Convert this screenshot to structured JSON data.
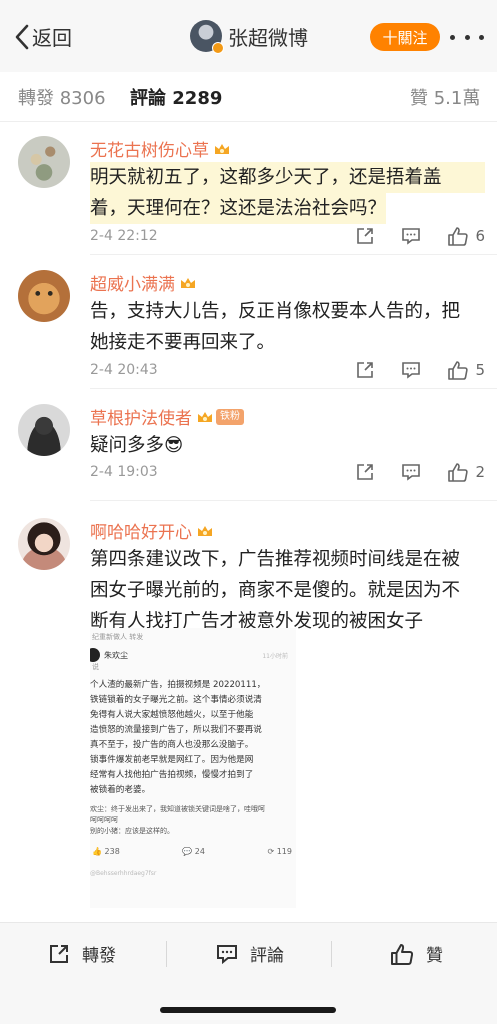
{
  "header": {
    "back_label": "返回",
    "title": "张超微博",
    "follow_label": "十關注"
  },
  "tabs": [
    {
      "label": "轉發 8306",
      "active": false
    },
    {
      "label": "評論 2289",
      "active": true
    },
    {
      "label": "贊 5.1萬",
      "active": false
    }
  ],
  "comments": [
    {
      "name": "无花古树伤心草",
      "text_lines": [
        "明天就初五了，这都多少天了，还是捂着盖",
        "着，天理何在？这还是法治社会吗？"
      ],
      "time": "2-4 22:12",
      "likes": "6"
    },
    {
      "name": "超威小满满",
      "text_lines": [
        "告，支持大儿告，反正肖像权要本人告的，把",
        "她接走不要再回来了。"
      ],
      "time": "2-4 20:43",
      "likes": "5"
    },
    {
      "name": "草根护法使者",
      "badge": "铁粉",
      "text_lines": [
        "疑问多多😎"
      ],
      "time": "2-4 19:03",
      "likes": "2"
    },
    {
      "name": "啊哈哈好开心",
      "text_lines": [
        "第四条建议改下，广告推荐视频时间线是在被",
        "困女子曝光前的，商家不是傻的。就是因为不",
        "断有人找打广告才被意外发现的被困女子"
      ]
    }
  ],
  "embed": {
    "header": "纪重新做人 转发",
    "user": "朱欢尘",
    "user_time": "11小时前",
    "user_sub": "说",
    "body_lines": [
      "个人渣的最新广告，拍摄视频是 20220111，",
      "铁链锁着的女子曝光之前。这个事情必须说清",
      "免得有人说大家越愤怒他越火，以至于他能",
      "造愤怒的流量接到广告了，所以我们不要再说",
      "真不至于，投广告的商人也没那么没脑子。",
      "锁事件爆发前老早就是网红了。因为他是网",
      "经常有人找他拍广告拍视频，慢慢才拍到了",
      "被锁着的老婆。"
    ],
    "reply_lines": [
      "欢尘：终于发出来了，我知道被锁关键词是啥了，哇哦呵",
      "呵呵呵呵",
      "别的小猪：应该是这样的。"
    ],
    "likes": "238",
    "comments": "24",
    "reposts": "119",
    "watermark": "@Behsserhhrdaeg7fsr"
  },
  "bottom": {
    "repost_label": "轉發",
    "comment_label": "評論",
    "like_label": "贊"
  },
  "colors": {
    "accent": "#ff8200",
    "username": "#eb7350",
    "highlight": "#fdf7d6"
  }
}
